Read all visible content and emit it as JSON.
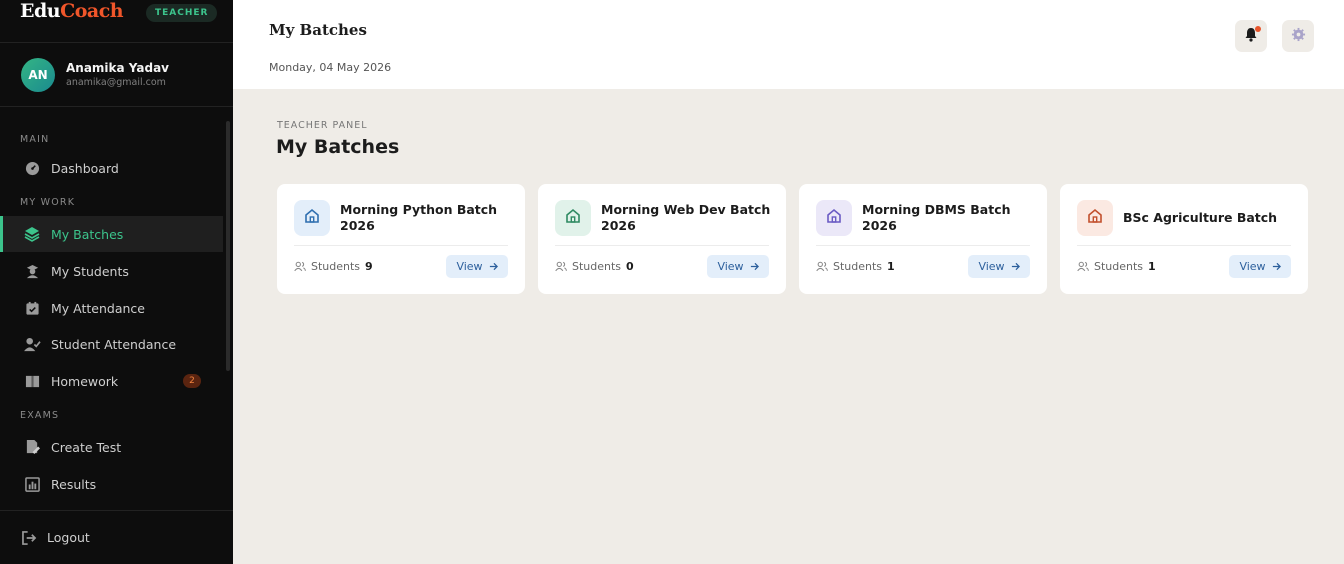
{
  "brand": {
    "part1": "Edu",
    "part2": "Coach",
    "role": "TEACHER"
  },
  "user": {
    "initials": "AN",
    "name": "Anamika Yadav",
    "email": "anamika@gmail.com"
  },
  "nav": {
    "sections": {
      "main": "MAIN",
      "work": "MY WORK",
      "exams": "EXAMS"
    },
    "items": [
      {
        "label": "Dashboard",
        "icon": "dashboard-icon"
      },
      {
        "label": "My Batches",
        "icon": "layers-icon",
        "active": true
      },
      {
        "label": "My Students",
        "icon": "student-icon"
      },
      {
        "label": "My Attendance",
        "icon": "calendar-check-icon"
      },
      {
        "label": "Student Attendance",
        "icon": "user-check-icon"
      },
      {
        "label": "Homework",
        "icon": "book-icon",
        "badge": "2"
      },
      {
        "label": "Create Test",
        "icon": "file-edit-icon"
      },
      {
        "label": "Results",
        "icon": "bar-chart-icon"
      }
    ],
    "logout": "Logout"
  },
  "topbar": {
    "title": "My Batches",
    "date": "Monday, 04 May 2026"
  },
  "main": {
    "label": "TEACHER PANEL",
    "title": "My Batches"
  },
  "batches": [
    {
      "name": "Morning Python Batch 2026",
      "students_label": "Students",
      "count": "9",
      "view": "View",
      "color": "#2f6fb0",
      "bg": "#e3eefa"
    },
    {
      "name": "Morning Web Dev Batch 2026",
      "students_label": "Students",
      "count": "0",
      "view": "View",
      "color": "#2f8a62",
      "bg": "#e1f2ea"
    },
    {
      "name": "Morning DBMS Batch 2026",
      "students_label": "Students",
      "count": "1",
      "view": "View",
      "color": "#6a5bc4",
      "bg": "#ebe8f8"
    },
    {
      "name": "BSc Agriculture Batch",
      "students_label": "Students",
      "count": "1",
      "view": "View",
      "color": "#c2502d",
      "bg": "#fbe9e2"
    }
  ]
}
